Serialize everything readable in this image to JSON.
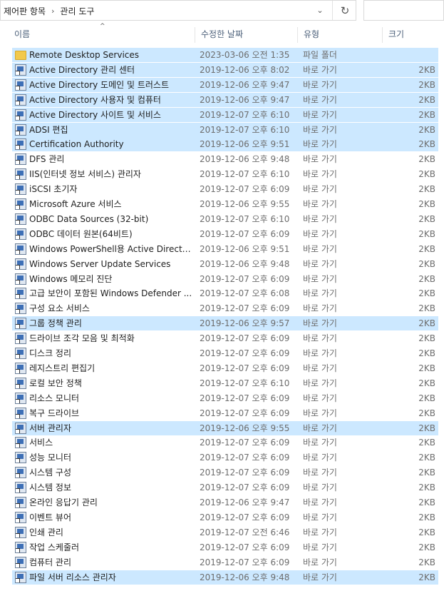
{
  "address": {
    "crumbs": [
      "제어판 항목",
      "관리 도구"
    ],
    "separator": "›",
    "dropdown_glyph": "⌄",
    "refresh_glyph": "↻"
  },
  "columns": {
    "name": "이름",
    "date": "수정한 날짜",
    "type": "유형",
    "size": "크기",
    "sort_glyph": "^"
  },
  "colors": {
    "selection": "#cce8ff",
    "header_text": "#4c607a"
  },
  "files": [
    {
      "name": "Remote Desktop Services",
      "date": "2023-03-06 오전 1:35",
      "type": "파일 폴더",
      "size": "",
      "icon": "folder-icon",
      "selected": true
    },
    {
      "name": "Active Directory 관리 센터",
      "date": "2019-12-06 오후 8:02",
      "type": "바로 가기",
      "size": "2KB",
      "icon": "shortcut-icon",
      "selected": true
    },
    {
      "name": "Active Directory 도메인 및 트러스트",
      "date": "2019-12-06 오후 9:47",
      "type": "바로 가기",
      "size": "2KB",
      "icon": "shortcut-icon",
      "selected": true
    },
    {
      "name": "Active Directory 사용자 및 컴퓨터",
      "date": "2019-12-06 오후 9:47",
      "type": "바로 가기",
      "size": "2KB",
      "icon": "shortcut-icon",
      "selected": true
    },
    {
      "name": "Active Directory 사이트 및 서비스",
      "date": "2019-12-07 오후 6:10",
      "type": "바로 가기",
      "size": "2KB",
      "icon": "shortcut-icon",
      "selected": true
    },
    {
      "name": "ADSI 편집",
      "date": "2019-12-07 오후 6:10",
      "type": "바로 가기",
      "size": "2KB",
      "icon": "shortcut-icon",
      "selected": true
    },
    {
      "name": "Certification Authority",
      "date": "2019-12-06 오후 9:51",
      "type": "바로 가기",
      "size": "2KB",
      "icon": "shortcut-icon",
      "selected": true
    },
    {
      "name": "DFS 관리",
      "date": "2019-12-06 오후 9:48",
      "type": "바로 가기",
      "size": "2KB",
      "icon": "shortcut-icon",
      "selected": false
    },
    {
      "name": "IIS(인터넷 정보 서비스) 관리자",
      "date": "2019-12-07 오후 6:10",
      "type": "바로 가기",
      "size": "2KB",
      "icon": "shortcut-icon",
      "selected": false
    },
    {
      "name": "iSCSI 초기자",
      "date": "2019-12-07 오후 6:09",
      "type": "바로 가기",
      "size": "2KB",
      "icon": "shortcut-icon",
      "selected": false
    },
    {
      "name": "Microsoft Azure 서비스",
      "date": "2019-12-06 오후 9:55",
      "type": "바로 가기",
      "size": "2KB",
      "icon": "shortcut-icon",
      "selected": false
    },
    {
      "name": "ODBC Data Sources (32-bit)",
      "date": "2019-12-07 오후 6:10",
      "type": "바로 가기",
      "size": "2KB",
      "icon": "shortcut-icon",
      "selected": false
    },
    {
      "name": "ODBC 데이터 원본(64비트)",
      "date": "2019-12-07 오후 6:09",
      "type": "바로 가기",
      "size": "2KB",
      "icon": "shortcut-icon",
      "selected": false
    },
    {
      "name": "Windows PowerShell용 Active Directory...",
      "date": "2019-12-06 오후 9:51",
      "type": "바로 가기",
      "size": "2KB",
      "icon": "shortcut-icon",
      "selected": false
    },
    {
      "name": "Windows Server Update Services",
      "date": "2019-12-06 오후 9:48",
      "type": "바로 가기",
      "size": "2KB",
      "icon": "shortcut-icon",
      "selected": false
    },
    {
      "name": "Windows 메모리 진단",
      "date": "2019-12-07 오후 6:09",
      "type": "바로 가기",
      "size": "2KB",
      "icon": "shortcut-icon",
      "selected": false
    },
    {
      "name": "고급 보안이 포함된 Windows Defender ...",
      "date": "2019-12-07 오후 6:08",
      "type": "바로 가기",
      "size": "2KB",
      "icon": "shortcut-icon",
      "selected": false
    },
    {
      "name": "구성 요소 서비스",
      "date": "2019-12-07 오후 6:09",
      "type": "바로 가기",
      "size": "2KB",
      "icon": "shortcut-icon",
      "selected": false
    },
    {
      "name": "그룹 정책 관리",
      "date": "2019-12-06 오후 9:57",
      "type": "바로 가기",
      "size": "2KB",
      "icon": "shortcut-icon",
      "selected": true
    },
    {
      "name": "드라이브 조각 모음 및 최적화",
      "date": "2019-12-07 오후 6:09",
      "type": "바로 가기",
      "size": "2KB",
      "icon": "shortcut-icon",
      "selected": false
    },
    {
      "name": "디스크 정리",
      "date": "2019-12-07 오후 6:09",
      "type": "바로 가기",
      "size": "2KB",
      "icon": "shortcut-icon",
      "selected": false
    },
    {
      "name": "레지스트리 편집기",
      "date": "2019-12-07 오후 6:09",
      "type": "바로 가기",
      "size": "2KB",
      "icon": "shortcut-icon",
      "selected": false
    },
    {
      "name": "로컬 보안 정책",
      "date": "2019-12-07 오후 6:10",
      "type": "바로 가기",
      "size": "2KB",
      "icon": "shortcut-icon",
      "selected": false
    },
    {
      "name": "리소스 모니터",
      "date": "2019-12-07 오후 6:09",
      "type": "바로 가기",
      "size": "2KB",
      "icon": "shortcut-icon",
      "selected": false
    },
    {
      "name": "복구 드라이브",
      "date": "2019-12-07 오후 6:09",
      "type": "바로 가기",
      "size": "2KB",
      "icon": "shortcut-icon",
      "selected": false
    },
    {
      "name": "서버 관리자",
      "date": "2019-12-06 오후 9:55",
      "type": "바로 가기",
      "size": "2KB",
      "icon": "shortcut-icon",
      "selected": true
    },
    {
      "name": "서비스",
      "date": "2019-12-07 오후 6:09",
      "type": "바로 가기",
      "size": "2KB",
      "icon": "shortcut-icon",
      "selected": false
    },
    {
      "name": "성능 모니터",
      "date": "2019-12-07 오후 6:09",
      "type": "바로 가기",
      "size": "2KB",
      "icon": "shortcut-icon",
      "selected": false
    },
    {
      "name": "시스템 구성",
      "date": "2019-12-07 오후 6:09",
      "type": "바로 가기",
      "size": "2KB",
      "icon": "shortcut-icon",
      "selected": false
    },
    {
      "name": "시스템 정보",
      "date": "2019-12-07 오후 6:09",
      "type": "바로 가기",
      "size": "2KB",
      "icon": "shortcut-icon",
      "selected": false
    },
    {
      "name": "온라인 응답기 관리",
      "date": "2019-12-06 오후 9:47",
      "type": "바로 가기",
      "size": "2KB",
      "icon": "shortcut-icon",
      "selected": false
    },
    {
      "name": "이벤트 뷰어",
      "date": "2019-12-07 오후 6:09",
      "type": "바로 가기",
      "size": "2KB",
      "icon": "shortcut-icon",
      "selected": false
    },
    {
      "name": "인쇄 관리",
      "date": "2019-12-07 오전 6:46",
      "type": "바로 가기",
      "size": "2KB",
      "icon": "shortcut-icon",
      "selected": false
    },
    {
      "name": "작업 스케줄러",
      "date": "2019-12-07 오후 6:09",
      "type": "바로 가기",
      "size": "2KB",
      "icon": "shortcut-icon",
      "selected": false
    },
    {
      "name": "컴퓨터 관리",
      "date": "2019-12-07 오후 6:09",
      "type": "바로 가기",
      "size": "2KB",
      "icon": "shortcut-icon",
      "selected": false
    },
    {
      "name": "파일 서버 리소스 관리자",
      "date": "2019-12-06 오후 9:48",
      "type": "바로 가기",
      "size": "2KB",
      "icon": "shortcut-icon",
      "selected": true
    }
  ]
}
